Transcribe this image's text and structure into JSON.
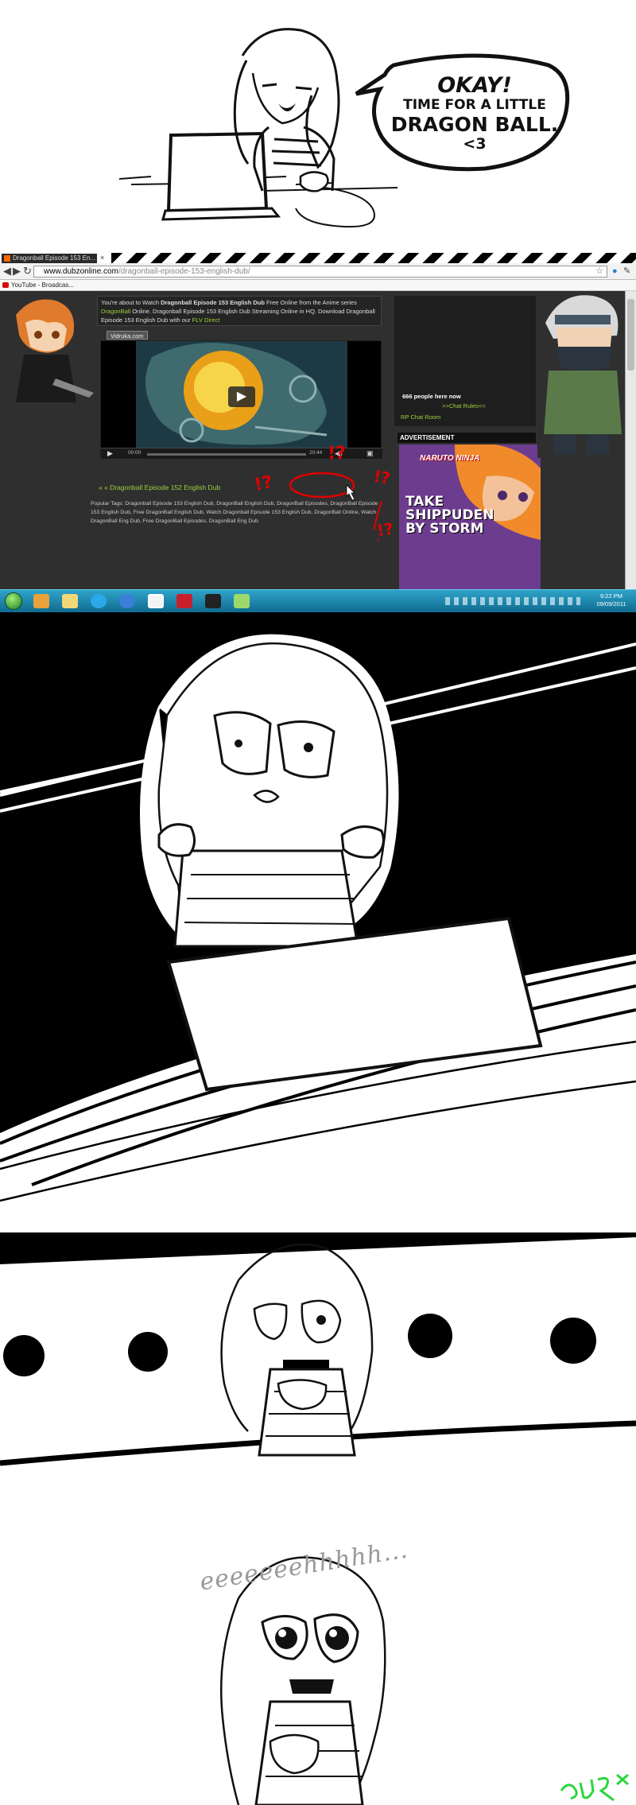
{
  "speech_bubble": {
    "line1": "OKAY!",
    "line2": "TIME FOR A LITTLE",
    "line3": "DRAGON BALL.",
    "line4": "<3"
  },
  "browser": {
    "tab_title": "Dragonball Episode 153 En...",
    "url_domain": "www.dubzonline.com",
    "url_path": "/dragonball-episode-153-english-dub/",
    "bookmark_label": "YouTube - Broadcas...",
    "page": {
      "intro_part1": "You're about to Watch ",
      "intro_bold1": "Dragonball Episode 153 English Dub",
      "intro_part2": " Free Online from the Anime series ",
      "intro_link1": "DragonBall",
      "intro_part3": " Online. Dragonball Episode 153 English Dub Streaming Online in HQ. Download Dragonball Episode 153 English Dub with our ",
      "intro_link2": "FLV Direct",
      "host_tab": "Vidruka.com",
      "time_current": "00:00",
      "time_total": "20:44",
      "prev_episode_link": "« « Dragonball Episode 152 English Dub",
      "tags_text": "Popular Tags: Dragonball Episode 153 English Dub, DragonBall English Dub, DragonBall Episodes, DragonBall Episode 153 English Dub, Free DragonBall English Dub, Watch Dragonball Episode 153 English Dub, DragonBall Online, Watch DragonBall Eng Dub, Free DragonBall Episodes, DragonBall Eng Dub",
      "chat_count": "666 people here now",
      "chat_rules": ">>Chat Rules<<",
      "chat_room": "RP Chat Room",
      "ad_header": "ADVERTISEMENT",
      "ad_brand": "NARUTO NINJA",
      "ad_text": "TAKE SHIPPUDEN BY STORM"
    },
    "annotation_marks": [
      "!?",
      "!?",
      "!?",
      "!?"
    ]
  },
  "taskbar": {
    "clock_time": "9:22 PM",
    "clock_date": "09/09/2011"
  },
  "panel5": {
    "caption": "eeeeeeehhhhh..."
  },
  "colors": {
    "site_background": "#2f2f2f",
    "link_green": "#9fd13c",
    "annotation_red": "#e00000",
    "taskbar_blue": "#1f8ab4",
    "signature_green": "#2bd63c"
  }
}
